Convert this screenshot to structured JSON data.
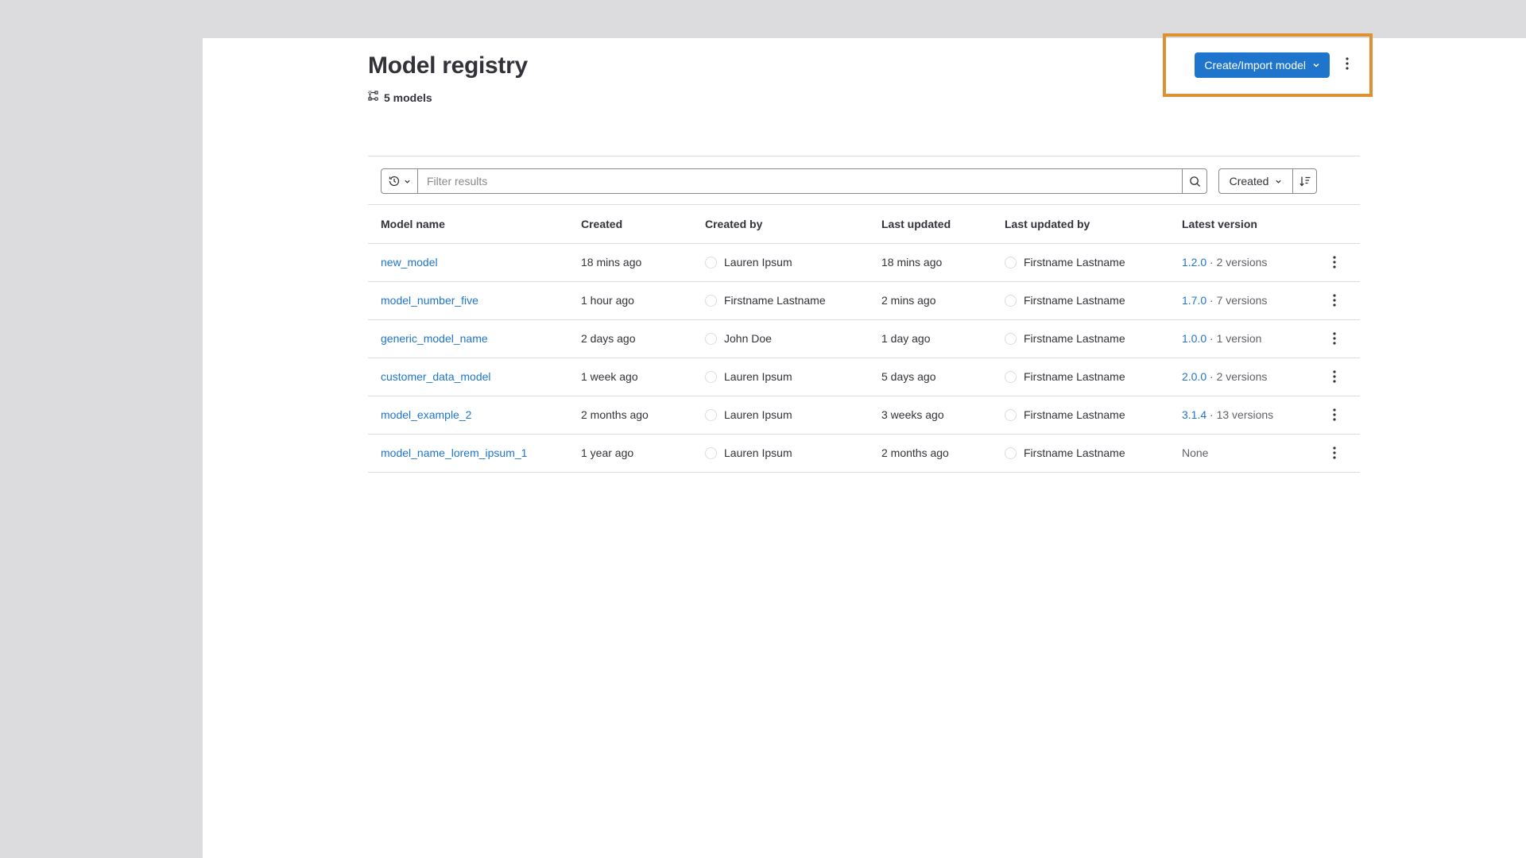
{
  "page": {
    "title": "Model registry",
    "model_count": "5 models"
  },
  "actions": {
    "create_label": "Create/Import model",
    "highlight_color": "#dd9231",
    "primary_color": "#1f75cb"
  },
  "filter": {
    "placeholder": "Filter results",
    "sort_label": "Created"
  },
  "table": {
    "headers": {
      "name": "Model name",
      "created": "Created",
      "created_by": "Created by",
      "last_updated": "Last updated",
      "last_updated_by": "Last updated by",
      "latest_version": "Latest version"
    },
    "rows": [
      {
        "name": "new_model",
        "created": "18 mins ago",
        "created_by": "Lauren Ipsum",
        "last_updated": "18 mins ago",
        "last_updated_by": "Firstname Lastname",
        "version": "1.2.0",
        "versions_count": " · 2 versions"
      },
      {
        "name": "model_number_five",
        "created": "1 hour ago",
        "created_by": "Firstname Lastname",
        "last_updated": "2 mins ago",
        "last_updated_by": "Firstname Lastname",
        "version": "1.7.0",
        "versions_count": " · 7 versions"
      },
      {
        "name": "generic_model_name",
        "created": "2 days ago",
        "created_by": "John Doe",
        "last_updated": "1 day ago",
        "last_updated_by": "Firstname Lastname",
        "version": "1.0.0",
        "versions_count": " · 1 version"
      },
      {
        "name": "customer_data_model",
        "created": "1 week ago",
        "created_by": "Lauren Ipsum",
        "last_updated": "5 days ago",
        "last_updated_by": "Firstname Lastname",
        "version": "2.0.0",
        "versions_count": " · 2 versions"
      },
      {
        "name": "model_example_2",
        "created": "2 months ago",
        "created_by": "Lauren Ipsum",
        "last_updated": "3 weeks ago",
        "last_updated_by": "Firstname Lastname",
        "version": "3.1.4",
        "versions_count": " · 13 versions"
      },
      {
        "name": "model_name_lorem_ipsum_1",
        "created": "1 year ago",
        "created_by": "Lauren Ipsum",
        "last_updated": "2 months ago",
        "last_updated_by": "Firstname Lastname",
        "version": "",
        "versions_count": "None"
      }
    ]
  }
}
